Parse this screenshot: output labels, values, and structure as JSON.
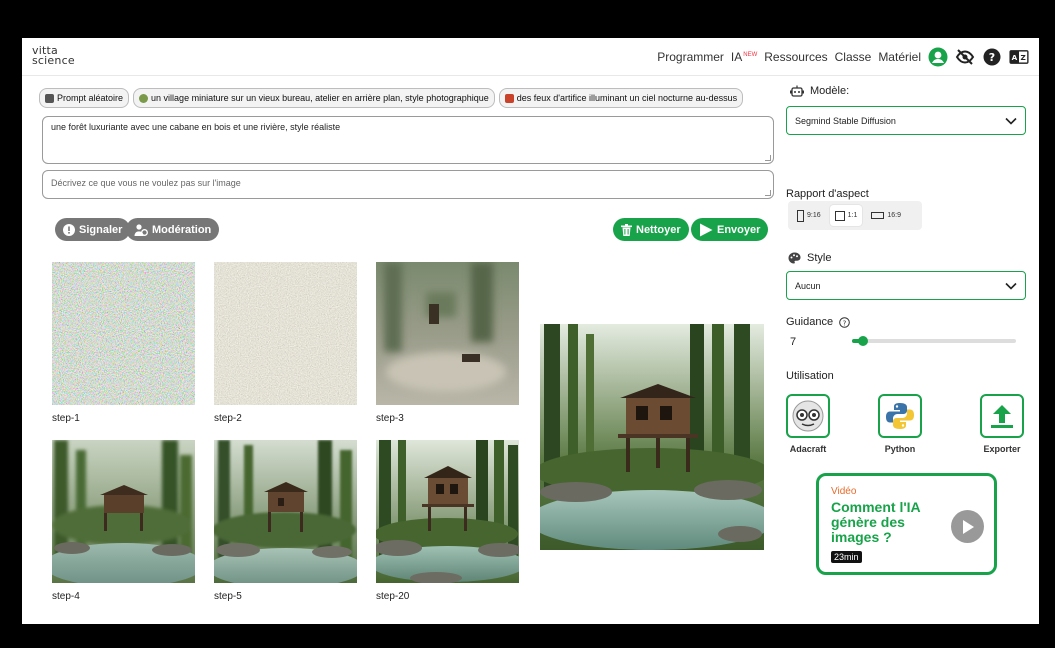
{
  "header": {
    "logo_line1": "vitta",
    "logo_line2": "science",
    "nav": {
      "programmer": "Programmer",
      "ia": "IA",
      "ia_badge": "NEW",
      "ressources": "Ressources",
      "classe": "Classe",
      "materiel": "Matériel"
    }
  },
  "prompts": {
    "chips": [
      {
        "label": "Prompt aléatoire",
        "icon": "random-icon"
      },
      {
        "label": "un village miniature sur un vieux bureau, atelier en arrière plan, style photographique",
        "icon": "village-icon"
      },
      {
        "label": "des feux d'artifice illuminant un ciel nocturne au-dessus",
        "icon": "fireworks-icon"
      }
    ],
    "prompt_value": "une forêt luxuriante avec une cabane en bois et une rivière, style réaliste",
    "negative_placeholder": "Décrivez ce que vous ne voulez pas sur l'image"
  },
  "actions": {
    "signaler": "Signaler",
    "moderation": "Modération",
    "nettoyer": "Nettoyer",
    "envoyer": "Envoyer"
  },
  "steps": [
    {
      "label": "step-1"
    },
    {
      "label": "step-2"
    },
    {
      "label": "step-3"
    },
    {
      "label": "step-4"
    },
    {
      "label": "step-5"
    },
    {
      "label": "step-20"
    }
  ],
  "sidebar": {
    "model_title": "Modèle:",
    "model_value": "Segmind Stable Diffusion",
    "aspect_title": "Rapport d'aspect",
    "aspects": [
      "9:16",
      "1:1",
      "16:9"
    ],
    "aspect_selected": "1:1",
    "style_title": "Style",
    "style_value": "Aucun",
    "guidance_title": "Guidance",
    "guidance_value": "7",
    "guidance_fraction": 0.07,
    "usage_title": "Utilisation",
    "tools": [
      {
        "label": "Adacraft",
        "icon": "adacraft-icon"
      },
      {
        "label": "Python",
        "icon": "python-icon"
      },
      {
        "label": "Exporter",
        "icon": "export-icon"
      }
    ],
    "video": {
      "kicker": "Vidéo",
      "title": "Comment l'IA génère des images ?",
      "duration": "23min"
    }
  },
  "colors": {
    "accent": "#18a34a",
    "grey_button": "#777777",
    "video_kicker": "#e86b2a"
  }
}
